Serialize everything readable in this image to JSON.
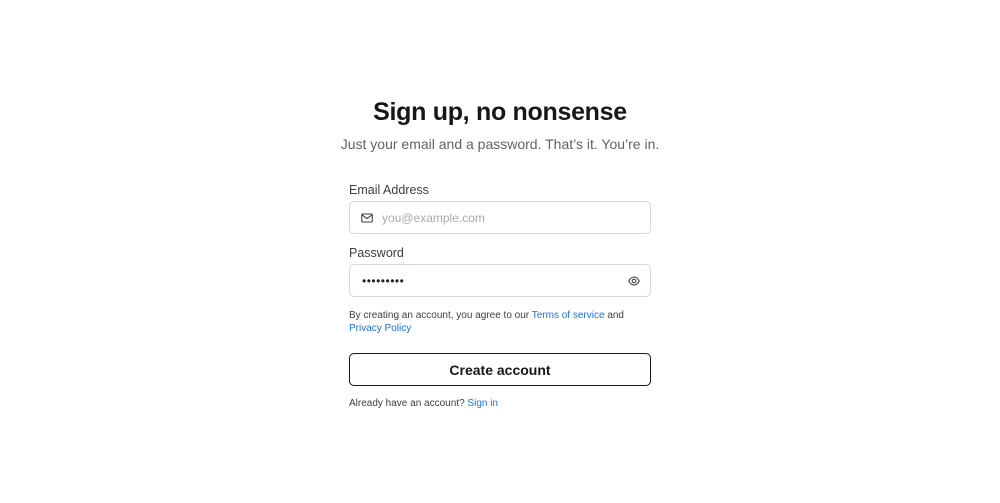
{
  "header": {
    "title": "Sign up, no nonsense",
    "subtitle": "Just your email and a password. That’s it. You’re in."
  },
  "form": {
    "email": {
      "label": "Email Address",
      "placeholder": "you@example.com",
      "value": "",
      "icon": "mail-icon"
    },
    "password": {
      "label": "Password",
      "value": "•••••••••",
      "icon": "eye-icon"
    },
    "terms": {
      "prefix": "By creating an account, you agree to our",
      "terms_link": "Terms of service",
      "conjunction": "and",
      "privacy_link": "Privacy Policy"
    },
    "submit_label": "Create account",
    "signin": {
      "prompt": "Already have an account?",
      "link": "Sign in"
    }
  },
  "colors": {
    "link": "#1a73e8",
    "text": "#15171a",
    "muted": "#5f6368",
    "border": "#d6d9de"
  }
}
